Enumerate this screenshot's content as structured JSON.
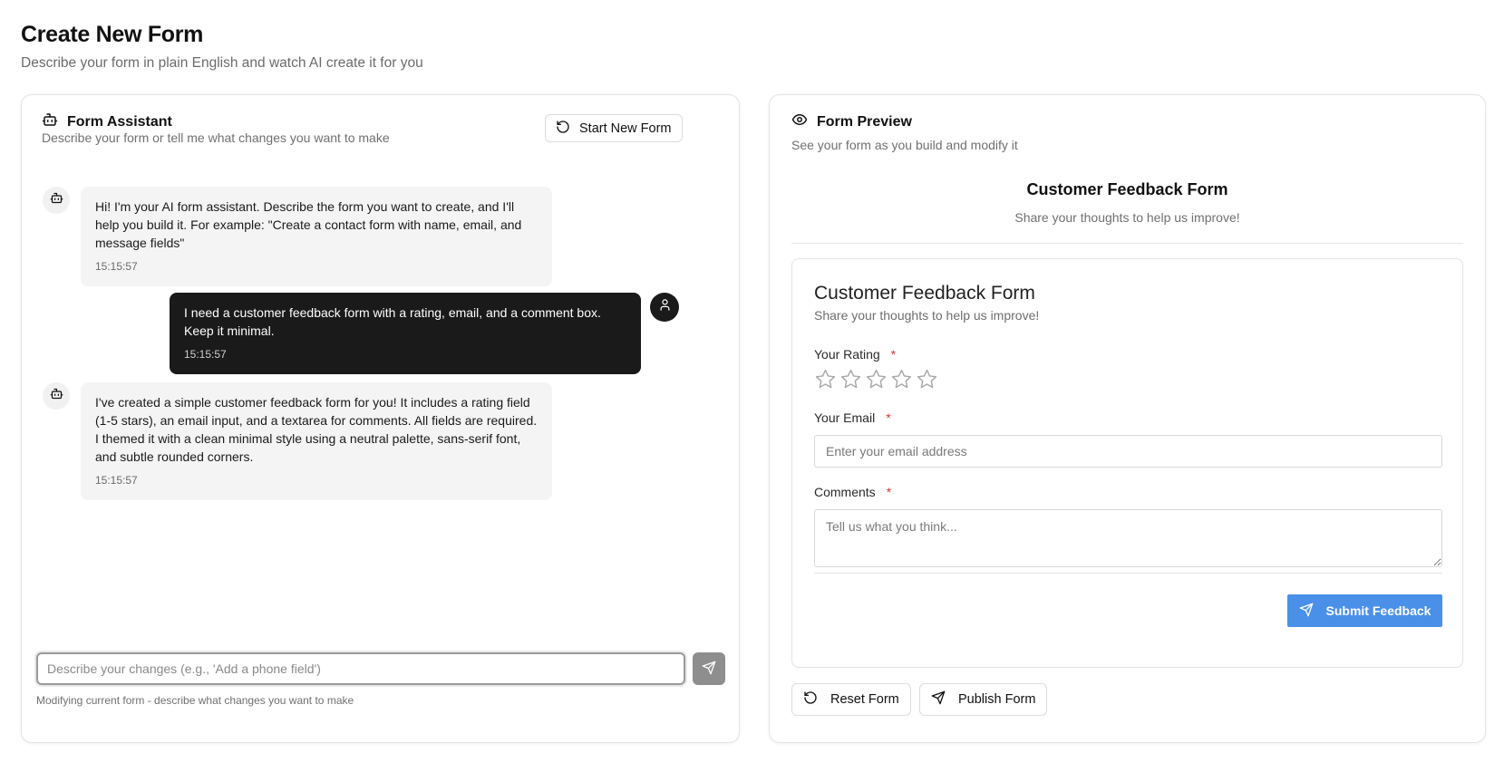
{
  "page": {
    "title": "Create New Form",
    "subtitle": "Describe your form in plain English and watch AI create it for you"
  },
  "assistant": {
    "title": "Form Assistant",
    "subtitle": "Describe your form or tell me what changes you want to make",
    "start_new_label": "Start New Form",
    "messages": [
      {
        "role": "bot",
        "text": "Hi! I'm your AI form assistant. Describe the form you want to create, and I'll help you build it. For example: \"Create a contact form with name, email, and message fields\"",
        "time": "15:15:57"
      },
      {
        "role": "user",
        "text": "I need a customer feedback form with a rating, email, and a comment box. Keep it minimal.",
        "time": "15:15:57"
      },
      {
        "role": "bot",
        "text": "I've created a simple customer feedback form for you! It includes a rating field (1-5 stars), an email input, and a textarea for comments. All fields are required. I themed it with a clean minimal style using a neutral palette, sans-serif font, and subtle rounded corners.",
        "time": "15:15:57"
      }
    ],
    "input_placeholder": "Describe your changes (e.g., 'Add a phone field')",
    "hint": "Modifying current form - describe what changes you want to make"
  },
  "preview": {
    "title": "Form Preview",
    "subtitle": "See your form as you build and modify it",
    "form_title": "Customer Feedback Form",
    "form_subtitle": "Share your thoughts to help us improve!",
    "card_title": "Customer Feedback Form",
    "card_subtitle": "Share your thoughts to help us improve!",
    "fields": {
      "rating": {
        "label": "Your Rating",
        "required_mark": "*",
        "max_stars": 5,
        "value": 0
      },
      "email": {
        "label": "Your Email",
        "required_mark": "*",
        "placeholder": "Enter your email address"
      },
      "comments": {
        "label": "Comments",
        "required_mark": "*",
        "placeholder": "Tell us what you think..."
      }
    },
    "submit_label": "Submit Feedback",
    "reset_label": "Reset Form",
    "publish_label": "Publish Form"
  },
  "colors": {
    "accent": "#4a90e8",
    "required": "#e0352b",
    "user_bubble": "#1a1a1a",
    "bot_bubble": "#f4f4f4"
  },
  "icons": {
    "assistant": "bot-icon",
    "preview": "eye-icon",
    "start_new": "refresh-icon",
    "send": "send-icon",
    "user": "user-icon",
    "reset": "refresh-icon",
    "publish": "send-icon"
  }
}
